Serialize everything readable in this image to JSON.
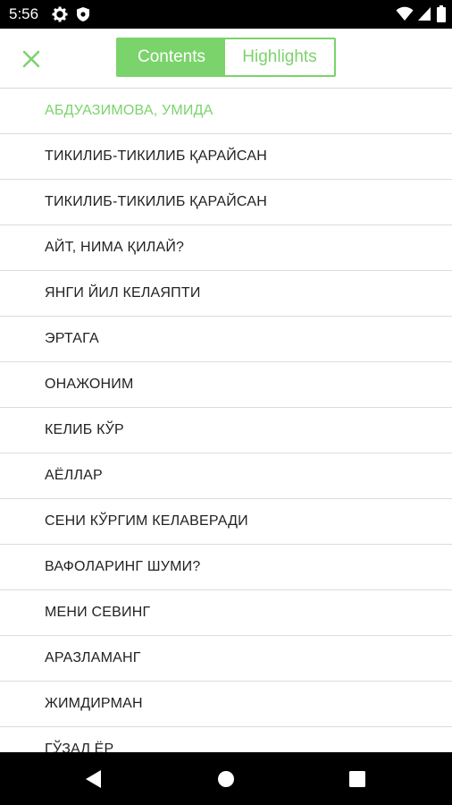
{
  "status_bar": {
    "time": "5:56",
    "icons": [
      "gear-icon",
      "shield-icon",
      "wifi-icon",
      "cellular-icon",
      "battery-icon"
    ]
  },
  "header": {
    "close_icon": "close-icon",
    "tabs": [
      {
        "label": "Contents",
        "active": true
      },
      {
        "label": "Highlights",
        "active": false
      }
    ]
  },
  "contents": {
    "items": [
      "АБДУАЗИМОВА, УМИДА",
      "ТИКИЛИБ-ТИКИЛИБ ҚАРАЙСАН",
      "ТИКИЛИБ-ТИКИЛИБ ҚАРАЙСАН",
      "АЙТ, НИМА ҚИЛАЙ?",
      "ЯНГИ ЙИЛ КЕЛАЯПТИ",
      "ЭРТАГА",
      "ОНАЖОНИМ",
      "КЕЛИБ КЎР",
      "АЁЛЛАР",
      "СЕНИ КЎРГИМ КЕЛАВЕРАДИ",
      "ВАФОЛАРИНГ ШУМИ?",
      "МЕНИ СЕВИНГ",
      "АРАЗЛАМАНГ",
      "ЖИМДИРМАН",
      "ГЎЗАЛ ЁР"
    ],
    "current_index": 0
  },
  "colors": {
    "accent": "#7bd36b",
    "text": "#222222",
    "divider": "#dcdcdc",
    "system_bar": "#000000"
  },
  "nav_bar": {
    "icons": [
      "back-icon",
      "home-icon",
      "recents-icon"
    ]
  }
}
